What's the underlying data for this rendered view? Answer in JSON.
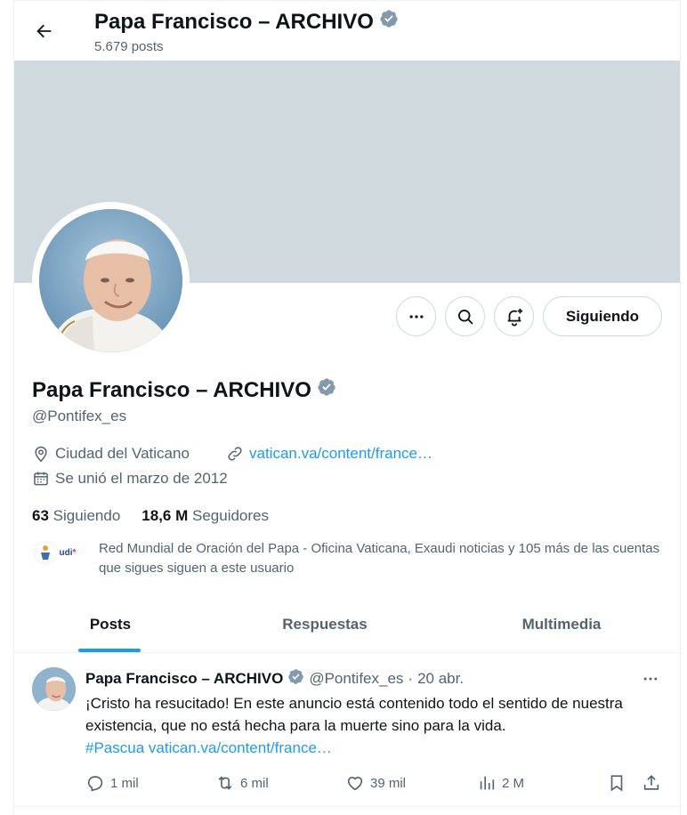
{
  "header": {
    "title": "Papa Francisco – ARCHIVO",
    "post_count": "5.679 posts"
  },
  "profile": {
    "name": "Papa Francisco – ARCHIVO",
    "handle": "@Pontifex_es",
    "location": "Ciudad del Vaticano",
    "website": "vatican.va/content/france…",
    "joined": "Se unió el marzo de 2012",
    "following_count": "63",
    "following_label": "Siguiendo",
    "followers_count": "18,6 M",
    "followers_label": "Seguidores",
    "followers_you_know": "Red Mundial de Oración del Papa - Oficina Vaticana, Exaudi noticias y 105 más de las cuentas que sigues siguen a este usuario",
    "follow_button": "Siguiendo",
    "verified_icon": "verified-badge-icon",
    "known_follower_avatar_text": "udi"
  },
  "tabs": [
    {
      "label": "Posts",
      "active": true
    },
    {
      "label": "Respuestas",
      "active": false
    },
    {
      "label": "Multimedia",
      "active": false
    }
  ],
  "tweet": {
    "name": "Papa Francisco – ARCHIVO",
    "handle": "@Pontifex_es",
    "separator": "·",
    "date": "20 abr.",
    "text_1": "¡Cristo ha resucitado! En este anuncio está contenido todo el sentido de nuestra existencia, que no está hecha para la muerte sino para la vida.",
    "hashtag": "#Pascua",
    "link": "vatican.va/content/france…",
    "replies": "1 mil",
    "reposts": "6 mil",
    "likes": "39 mil",
    "views": "2 M"
  },
  "colors": {
    "accent": "#1d9bf0",
    "banner": "#cfd9de",
    "verified": "#829aab",
    "text": "#0f1419",
    "muted": "#536471"
  }
}
